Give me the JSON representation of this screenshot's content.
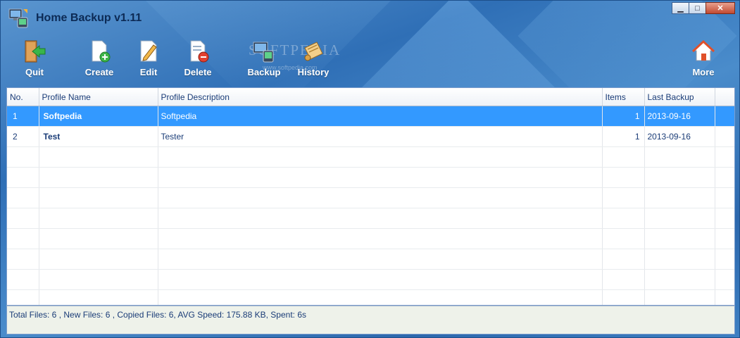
{
  "window": {
    "title": "Home Backup v1.11",
    "controls": {
      "minimize": "▁",
      "maximize": "□",
      "close": "✕"
    }
  },
  "watermark": {
    "text": "SOFTPEDIA",
    "url": "www.softpedia.com"
  },
  "toolbar": {
    "quit": "Quit",
    "create": "Create",
    "edit": "Edit",
    "delete": "Delete",
    "backup": "Backup",
    "history": "History",
    "more": "More"
  },
  "table": {
    "columns": [
      "No.",
      "Profile Name",
      "Profile Description",
      "Items",
      "Last Backup"
    ],
    "rows": [
      {
        "no": "1",
        "name": "Softpedia",
        "description": "Softpedia",
        "items": "1",
        "last_backup": "2013-09-16",
        "selected": true
      },
      {
        "no": "2",
        "name": "Test",
        "description": "Tester",
        "items": "1",
        "last_backup": "2013-09-16",
        "selected": false
      }
    ]
  },
  "status": {
    "text": "Total Files: 6 , New Files: 6 , Copied Files: 6, AVG Speed: 175.88 KB, Spent: 6s"
  },
  "colors": {
    "selection": "#3399ff",
    "background": "#2f6fb6",
    "text": "#1a3c77"
  }
}
